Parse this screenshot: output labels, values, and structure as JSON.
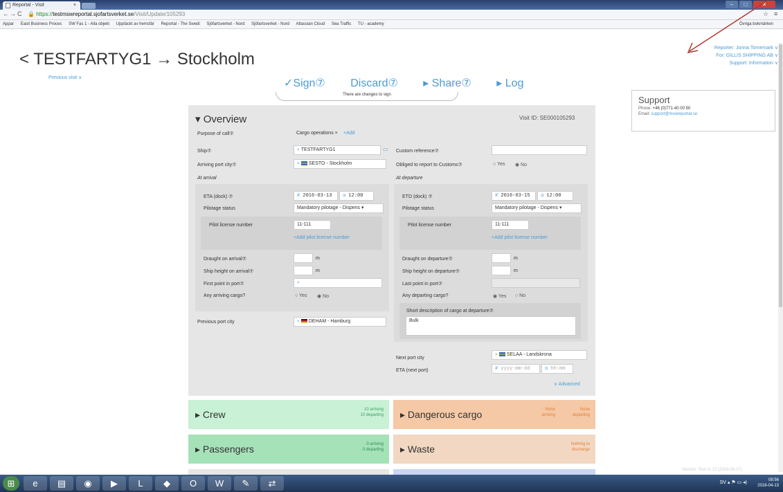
{
  "browser": {
    "tab_title": "Reportal - Visit",
    "tab_close": "×",
    "url_scheme": "https://",
    "url_host": "testmswreportal.sjofartsverket.se",
    "url_path": "/Visit/Update/105293",
    "bookmarks": [
      "Appar",
      "Easit Business Proces",
      "SW Fas 1 - Alla objekt",
      "Upptäckt av hemsfär",
      "Reportal - The Swedi",
      "Sjöfartsverket - Nord",
      "Sjöfartsverket - Nord",
      "Atlassian Cloud",
      "Sea Traffic",
      "TU - academy"
    ],
    "other_bookmarks": "Övriga bokmärken"
  },
  "header": {
    "title": "< TESTFARTYG1 → Stockholm",
    "previous_visit": "Previous visit ∨",
    "reporter": "Reporter: Jonna Tornemark ∨",
    "for": "For: GILLIS SHIPPING AB ∨",
    "support": "Support: Information ∨"
  },
  "actions": {
    "sign": "✓Sign⑦",
    "discard": "Discard⑦",
    "share": "▸ Share⑦",
    "log": "▸ Log",
    "changes_note": "There are changes to sign"
  },
  "support_box": {
    "title": "Support",
    "phone_label": "Phone:",
    "phone": "+46 (0)771-40 00 50",
    "email_label": "Email:",
    "email": "support@mswreportal.se"
  },
  "overview": {
    "heading": "▾ Overview",
    "visit_id": "Visit ID: SE000105293",
    "purpose_label": "Purpose of call⑦",
    "purpose_value": "Cargo operations ×",
    "purpose_add": "+Add",
    "ship_label": "Ship⑦",
    "ship_value": "TESTFARTYG1",
    "custom_ref_label": "Custom reference⑦",
    "arriving_port_label": "Arriving port city⑦",
    "arriving_port_value": "SESTO - Stockholm",
    "customs_label": "Obliged to report to Customs⑦",
    "customs_yes": "○ Yes",
    "customs_no": "◉ No",
    "at_arrival": "At arrival",
    "at_departure": "At departure",
    "eta_label": "ETA (dock) ⑦",
    "eta_date": "2016-03-13",
    "eta_time": "12:00",
    "etd_label": "ETD (dock) ⑦",
    "etd_date": "2016-03-15",
    "etd_time": "12:00",
    "pilotage_label": "Pilotage status",
    "pilotage_value": "Mandatory pilotage - Dispens ▾",
    "pilot_license_label": "Pilot license number",
    "pilot_license_value": "11-111",
    "add_pilot_license": "+Add pilot license number",
    "draught_arrival_label": "Draught on arrival⑦",
    "ship_height_arrival_label": "Ship height on arrival⑦",
    "first_point_label": "First point in port⑦",
    "arriving_cargo_label": "Any arriving cargo?",
    "arr_cargo_yes": "○ Yes",
    "arr_cargo_no": "◉ No",
    "draught_departure_label": "Draught on departure⑦",
    "ship_height_departure_label": "Ship height on departure⑦",
    "last_point_label": "Last point in port⑦",
    "departing_cargo_label": "Any departing cargo?",
    "dep_cargo_yes": "◉ Yes",
    "dep_cargo_no": "○ No",
    "unit_m": "m",
    "short_desc_label": "Short description of cargo at departure⑦",
    "short_desc_value": "Bulk",
    "previous_port_label": "Previous port city",
    "previous_port_value": "DEHAM - Hamburg",
    "next_port_label": "Next port city",
    "next_port_value": "SELAA - Landskrona",
    "eta_next_label": "ETA (next port)",
    "eta_next_date_ph": "yyyy-mm-dd",
    "eta_next_time_ph": "hh:mm",
    "advanced": "∨ Advanced"
  },
  "cards": {
    "crew": "▸ Crew",
    "crew_sub1": "10 arriving",
    "crew_sub2": "10 departing",
    "dangerous": "▸ Dangerous cargo",
    "dangerous_sub1": "None",
    "dangerous_sub2": "arriving",
    "dangerous_sub3": "None",
    "dangerous_sub4": "departing",
    "passengers": "▸ Passengers",
    "passengers_sub1": "0 arriving",
    "passengers_sub2": "0 departing",
    "waste": "▸ Waste",
    "waste_sub1": "Nothing to",
    "waste_sub2": "discharge"
  },
  "footer": {
    "version": "Version: Test v1.12 (2016-04-07)",
    "clock_time": "08:56",
    "clock_date": "2016-04-13",
    "lang": "SV"
  },
  "colors": {
    "accent": "#4a9bd5",
    "crew_bg": "#c8f1d6",
    "passengers_bg": "#a5e2b8",
    "dangerous_bg": "#f5c8a6",
    "waste_bg": "#f2d8c2",
    "panel_bg": "#e6e6e6"
  }
}
